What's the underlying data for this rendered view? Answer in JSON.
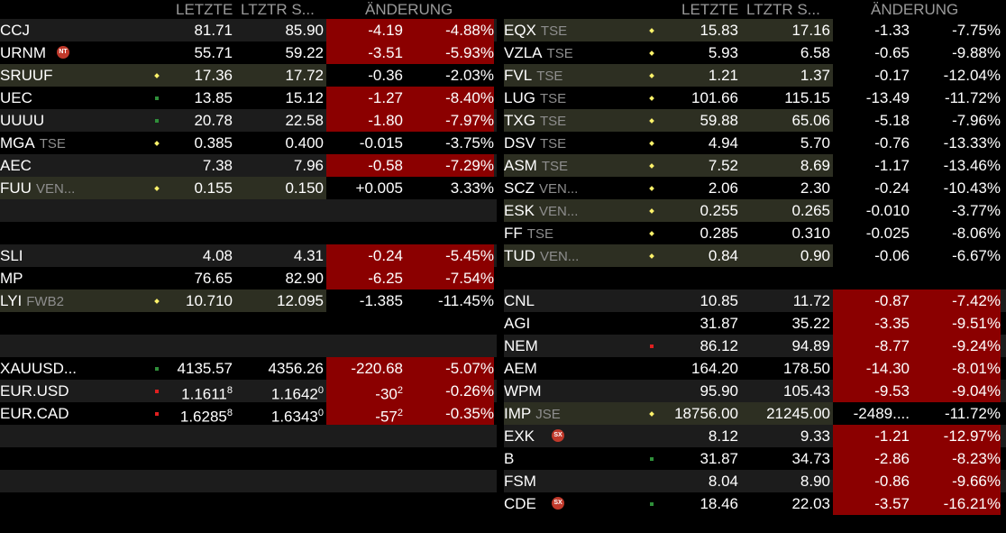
{
  "headers": {
    "last": "LETZTE",
    "prev": "LTZTR S...",
    "change": "ÄNDERUNG"
  },
  "colors": {
    "negative_bg": "#8b0000",
    "marker_yellow": "#fff36a",
    "marker_green": "#2f8f3a",
    "marker_red": "#e02020"
  },
  "left_rows": [
    {
      "symbol": "CCJ",
      "sub": "",
      "marker": "",
      "badge": "",
      "last": "81.71",
      "last_sup": "",
      "prev": "85.90",
      "prev_sup": "",
      "chg": "-4.19",
      "chg_sup": "",
      "pct": "-4.88%",
      "red": true,
      "bg": "dark"
    },
    {
      "symbol": "URNM",
      "sub": "",
      "marker": "",
      "badge": "NT",
      "last": "55.71",
      "last_sup": "",
      "prev": "59.22",
      "prev_sup": "",
      "chg": "-3.51",
      "chg_sup": "",
      "pct": "-5.93%",
      "red": true,
      "bg": "black"
    },
    {
      "symbol": "SRUUF",
      "sub": "",
      "marker": "yellow",
      "badge": "",
      "last": "17.36",
      "last_sup": "",
      "prev": "17.72",
      "prev_sup": "",
      "chg": "-0.36",
      "chg_sup": "",
      "pct": "-2.03%",
      "red": false,
      "bg": "olive"
    },
    {
      "symbol": "UEC",
      "sub": "",
      "marker": "green",
      "badge": "",
      "last": "13.85",
      "last_sup": "",
      "prev": "15.12",
      "prev_sup": "",
      "chg": "-1.27",
      "chg_sup": "",
      "pct": "-8.40%",
      "red": true,
      "bg": "black"
    },
    {
      "symbol": "UUUU",
      "sub": "",
      "marker": "green",
      "badge": "",
      "last": "20.78",
      "last_sup": "",
      "prev": "22.58",
      "prev_sup": "",
      "chg": "-1.80",
      "chg_sup": "",
      "pct": "-7.97%",
      "red": true,
      "bg": "dark"
    },
    {
      "symbol": "MGA",
      "sub": "TSE",
      "marker": "yellow",
      "badge": "",
      "last": "0.385",
      "last_sup": "",
      "prev": "0.400",
      "prev_sup": "",
      "chg": "-0.015",
      "chg_sup": "",
      "pct": "-3.75%",
      "red": false,
      "bg": "black"
    },
    {
      "symbol": "AEC",
      "sub": "",
      "marker": "",
      "badge": "",
      "last": "7.38",
      "last_sup": "",
      "prev": "7.96",
      "prev_sup": "",
      "chg": "-0.58",
      "chg_sup": "",
      "pct": "-7.29%",
      "red": true,
      "bg": "dark"
    },
    {
      "symbol": "FUU",
      "sub": "VEN...",
      "marker": "yellow",
      "badge": "",
      "last": "0.155",
      "last_sup": "",
      "prev": "0.150",
      "prev_sup": "",
      "chg": "+0.005",
      "chg_sup": "",
      "pct": "3.33%",
      "red": false,
      "bg": "olive"
    },
    {
      "symbol": "",
      "sub": "",
      "marker": "",
      "badge": "",
      "last": "",
      "last_sup": "",
      "prev": "",
      "prev_sup": "",
      "chg": "",
      "chg_sup": "",
      "pct": "",
      "red": false,
      "bg": "dark"
    },
    {
      "symbol": "",
      "sub": "",
      "marker": "",
      "badge": "",
      "last": "",
      "last_sup": "",
      "prev": "",
      "prev_sup": "",
      "chg": "",
      "chg_sup": "",
      "pct": "",
      "red": false,
      "bg": "black"
    },
    {
      "symbol": "SLI",
      "sub": "",
      "marker": "",
      "badge": "",
      "last": "4.08",
      "last_sup": "",
      "prev": "4.31",
      "prev_sup": "",
      "chg": "-0.24",
      "chg_sup": "",
      "pct": "-5.45%",
      "red": true,
      "bg": "dark"
    },
    {
      "symbol": "MP",
      "sub": "",
      "marker": "",
      "badge": "",
      "last": "76.65",
      "last_sup": "",
      "prev": "82.90",
      "prev_sup": "",
      "chg": "-6.25",
      "chg_sup": "",
      "pct": "-7.54%",
      "red": true,
      "bg": "black"
    },
    {
      "symbol": "LYI",
      "sub": "FWB2",
      "marker": "yellow",
      "badge": "",
      "last": "10.710",
      "last_sup": "",
      "prev": "12.095",
      "prev_sup": "",
      "chg": "-1.385",
      "chg_sup": "",
      "pct": "-11.45%",
      "red": false,
      "bg": "olive"
    },
    {
      "symbol": "",
      "sub": "",
      "marker": "",
      "badge": "",
      "last": "",
      "last_sup": "",
      "prev": "",
      "prev_sup": "",
      "chg": "",
      "chg_sup": "",
      "pct": "",
      "red": false,
      "bg": "black"
    },
    {
      "symbol": "",
      "sub": "",
      "marker": "",
      "badge": "",
      "last": "",
      "last_sup": "",
      "prev": "",
      "prev_sup": "",
      "chg": "",
      "chg_sup": "",
      "pct": "",
      "red": false,
      "bg": "dark"
    },
    {
      "symbol": "XAUUSD...",
      "sub": "",
      "marker": "green",
      "badge": "",
      "last": "4135.57",
      "last_sup": "",
      "prev": "4356.26",
      "prev_sup": "",
      "chg": "-220.68",
      "chg_sup": "",
      "pct": "-5.07%",
      "red": true,
      "bg": "black"
    },
    {
      "symbol": "EUR.USD",
      "sub": "",
      "marker": "red",
      "badge": "",
      "last": "1.1611",
      "last_sup": "8",
      "prev": "1.1642",
      "prev_sup": "0",
      "chg": "-30",
      "chg_sup": "2",
      "pct": "-0.26%",
      "red": true,
      "bg": "dark"
    },
    {
      "symbol": "EUR.CAD",
      "sub": "",
      "marker": "red",
      "badge": "",
      "last": "1.6285",
      "last_sup": "8",
      "prev": "1.6343",
      "prev_sup": "0",
      "chg": "-57",
      "chg_sup": "2",
      "pct": "-0.35%",
      "red": true,
      "bg": "black"
    },
    {
      "symbol": "",
      "sub": "",
      "marker": "",
      "badge": "",
      "last": "",
      "last_sup": "",
      "prev": "",
      "prev_sup": "",
      "chg": "",
      "chg_sup": "",
      "pct": "",
      "red": false,
      "bg": "dark"
    },
    {
      "symbol": "",
      "sub": "",
      "marker": "",
      "badge": "",
      "last": "",
      "last_sup": "",
      "prev": "",
      "prev_sup": "",
      "chg": "",
      "chg_sup": "",
      "pct": "",
      "red": false,
      "bg": "black"
    },
    {
      "symbol": "",
      "sub": "",
      "marker": "",
      "badge": "",
      "last": "",
      "last_sup": "",
      "prev": "",
      "prev_sup": "",
      "chg": "",
      "chg_sup": "",
      "pct": "",
      "red": false,
      "bg": "dark"
    }
  ],
  "right_rows": [
    {
      "symbol": "EQX",
      "sub": "TSE",
      "marker": "yellow",
      "badge": "",
      "last": "15.83",
      "last_sup": "",
      "prev": "17.16",
      "prev_sup": "",
      "chg": "-1.33",
      "chg_sup": "",
      "pct": "-7.75%",
      "red": false,
      "bg": "olive"
    },
    {
      "symbol": "VZLA",
      "sub": "TSE",
      "marker": "yellow",
      "badge": "",
      "last": "5.93",
      "last_sup": "",
      "prev": "6.58",
      "prev_sup": "",
      "chg": "-0.65",
      "chg_sup": "",
      "pct": "-9.88%",
      "red": false,
      "bg": "black"
    },
    {
      "symbol": "FVL",
      "sub": "TSE",
      "marker": "yellow",
      "badge": "",
      "last": "1.21",
      "last_sup": "",
      "prev": "1.37",
      "prev_sup": "",
      "chg": "-0.17",
      "chg_sup": "",
      "pct": "-12.04%",
      "red": false,
      "bg": "olive"
    },
    {
      "symbol": "LUG",
      "sub": "TSE",
      "marker": "yellow",
      "badge": "",
      "last": "101.66",
      "last_sup": "",
      "prev": "115.15",
      "prev_sup": "",
      "chg": "-13.49",
      "chg_sup": "",
      "pct": "-11.72%",
      "red": false,
      "bg": "black"
    },
    {
      "symbol": "TXG",
      "sub": "TSE",
      "marker": "yellow",
      "badge": "",
      "last": "59.88",
      "last_sup": "",
      "prev": "65.06",
      "prev_sup": "",
      "chg": "-5.18",
      "chg_sup": "",
      "pct": "-7.96%",
      "red": false,
      "bg": "olive"
    },
    {
      "symbol": "DSV",
      "sub": "TSE",
      "marker": "yellow",
      "badge": "",
      "last": "4.94",
      "last_sup": "",
      "prev": "5.70",
      "prev_sup": "",
      "chg": "-0.76",
      "chg_sup": "",
      "pct": "-13.33%",
      "red": false,
      "bg": "black"
    },
    {
      "symbol": "ASM",
      "sub": "TSE",
      "marker": "yellow",
      "badge": "",
      "last": "7.52",
      "last_sup": "",
      "prev": "8.69",
      "prev_sup": "",
      "chg": "-1.17",
      "chg_sup": "",
      "pct": "-13.46%",
      "red": false,
      "bg": "olive"
    },
    {
      "symbol": "SCZ",
      "sub": "VEN...",
      "marker": "yellow",
      "badge": "",
      "last": "2.06",
      "last_sup": "",
      "prev": "2.30",
      "prev_sup": "",
      "chg": "-0.24",
      "chg_sup": "",
      "pct": "-10.43%",
      "red": false,
      "bg": "black"
    },
    {
      "symbol": "ESK",
      "sub": "VEN...",
      "marker": "yellow",
      "badge": "",
      "last": "0.255",
      "last_sup": "",
      "prev": "0.265",
      "prev_sup": "",
      "chg": "-0.010",
      "chg_sup": "",
      "pct": "-3.77%",
      "red": false,
      "bg": "olive"
    },
    {
      "symbol": "FF",
      "sub": "TSE",
      "marker": "yellow",
      "badge": "",
      "last": "0.285",
      "last_sup": "",
      "prev": "0.310",
      "prev_sup": "",
      "chg": "-0.025",
      "chg_sup": "",
      "pct": "-8.06%",
      "red": false,
      "bg": "black"
    },
    {
      "symbol": "TUD",
      "sub": "VEN...",
      "marker": "yellow",
      "badge": "",
      "last": "0.84",
      "last_sup": "",
      "prev": "0.90",
      "prev_sup": "",
      "chg": "-0.06",
      "chg_sup": "",
      "pct": "-6.67%",
      "red": false,
      "bg": "olive"
    },
    {
      "symbol": "",
      "sub": "",
      "marker": "",
      "badge": "",
      "last": "",
      "last_sup": "",
      "prev": "",
      "prev_sup": "",
      "chg": "",
      "chg_sup": "",
      "pct": "",
      "red": false,
      "bg": "black"
    },
    {
      "symbol": "CNL",
      "sub": "",
      "marker": "",
      "badge": "",
      "last": "10.85",
      "last_sup": "",
      "prev": "11.72",
      "prev_sup": "",
      "chg": "-0.87",
      "chg_sup": "",
      "pct": "-7.42%",
      "red": true,
      "bg": "dark"
    },
    {
      "symbol": "AGI",
      "sub": "",
      "marker": "",
      "badge": "",
      "last": "31.87",
      "last_sup": "",
      "prev": "35.22",
      "prev_sup": "",
      "chg": "-3.35",
      "chg_sup": "",
      "pct": "-9.51%",
      "red": true,
      "bg": "black"
    },
    {
      "symbol": "NEM",
      "sub": "",
      "marker": "red",
      "badge": "",
      "last": "86.12",
      "last_sup": "",
      "prev": "94.89",
      "prev_sup": "",
      "chg": "-8.77",
      "chg_sup": "",
      "pct": "-9.24%",
      "red": true,
      "bg": "dark"
    },
    {
      "symbol": "AEM",
      "sub": "",
      "marker": "",
      "badge": "",
      "last": "164.20",
      "last_sup": "",
      "prev": "178.50",
      "prev_sup": "",
      "chg": "-14.30",
      "chg_sup": "",
      "pct": "-8.01%",
      "red": true,
      "bg": "black"
    },
    {
      "symbol": "WPM",
      "sub": "",
      "marker": "",
      "badge": "",
      "last": "95.90",
      "last_sup": "",
      "prev": "105.43",
      "prev_sup": "",
      "chg": "-9.53",
      "chg_sup": "",
      "pct": "-9.04%",
      "red": true,
      "bg": "dark"
    },
    {
      "symbol": "IMP",
      "sub": "JSE",
      "marker": "yellow",
      "badge": "",
      "last": "18756.00",
      "last_sup": "",
      "prev": "21245.00",
      "prev_sup": "",
      "chg": "-2489....",
      "chg_sup": "",
      "pct": "-11.72%",
      "red": false,
      "bg": "olive"
    },
    {
      "symbol": "EXK",
      "sub": "",
      "marker": "",
      "badge": "SX",
      "last": "8.12",
      "last_sup": "",
      "prev": "9.33",
      "prev_sup": "",
      "chg": "-1.21",
      "chg_sup": "",
      "pct": "-12.97%",
      "red": true,
      "bg": "dark"
    },
    {
      "symbol": "B",
      "sub": "",
      "marker": "green",
      "badge": "",
      "last": "31.87",
      "last_sup": "",
      "prev": "34.73",
      "prev_sup": "",
      "chg": "-2.86",
      "chg_sup": "",
      "pct": "-8.23%",
      "red": true,
      "bg": "black"
    },
    {
      "symbol": "FSM",
      "sub": "",
      "marker": "",
      "badge": "",
      "last": "8.04",
      "last_sup": "",
      "prev": "8.90",
      "prev_sup": "",
      "chg": "-0.86",
      "chg_sup": "",
      "pct": "-9.66%",
      "red": true,
      "bg": "dark"
    },
    {
      "symbol": "CDE",
      "sub": "",
      "marker": "green",
      "badge": "SX",
      "last": "18.46",
      "last_sup": "",
      "prev": "22.03",
      "prev_sup": "",
      "chg": "-3.57",
      "chg_sup": "",
      "pct": "-16.21%",
      "red": true,
      "bg": "black"
    }
  ]
}
